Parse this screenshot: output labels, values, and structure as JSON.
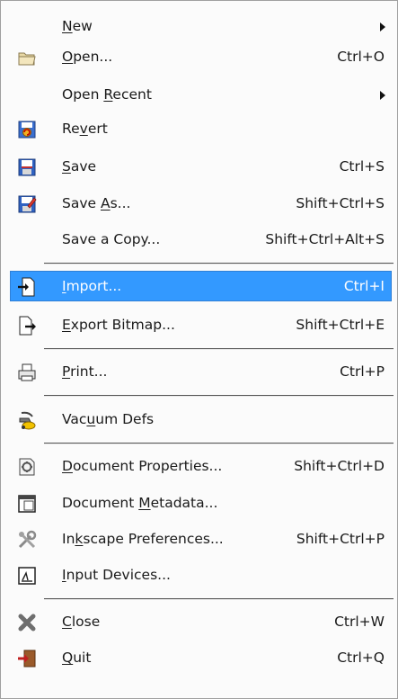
{
  "menu": {
    "items": [
      {
        "pre": "",
        "u": "N",
        "post": "ew",
        "accel": "",
        "submenu": true,
        "icon": ""
      },
      {
        "pre": "",
        "u": "O",
        "post": "pen...",
        "accel": "Ctrl+O",
        "icon": "folder-open-icon"
      },
      {
        "pre": "Open ",
        "u": "R",
        "post": "ecent",
        "accel": "",
        "submenu": true,
        "icon": ""
      },
      {
        "pre": "Re",
        "u": "v",
        "post": "ert",
        "accel": "",
        "icon": "revert-icon"
      },
      {
        "pre": "",
        "u": "S",
        "post": "ave",
        "accel": "Ctrl+S",
        "icon": "save-icon"
      },
      {
        "pre": "Save ",
        "u": "A",
        "post": "s...",
        "accel": "Shift+Ctrl+S",
        "icon": "save-as-icon"
      },
      {
        "pre": "Save a Copy...",
        "u": "",
        "post": "",
        "accel": "Shift+Ctrl+Alt+S",
        "icon": ""
      },
      {
        "pre": "",
        "u": "I",
        "post": "mport...",
        "accel": "Ctrl+I",
        "icon": "import-icon",
        "highlighted": true
      },
      {
        "pre": "",
        "u": "E",
        "post": "xport Bitmap...",
        "accel": "Shift+Ctrl+E",
        "icon": "export-icon"
      },
      {
        "pre": "",
        "u": "P",
        "post": "rint...",
        "accel": "Ctrl+P",
        "icon": "printer-icon"
      },
      {
        "pre": "Vac",
        "u": "u",
        "post": "um Defs",
        "accel": "",
        "icon": "vacuum-icon"
      },
      {
        "pre": "",
        "u": "D",
        "post": "ocument Properties...",
        "accel": "Shift+Ctrl+D",
        "icon": "document-properties-icon"
      },
      {
        "pre": "Document ",
        "u": "M",
        "post": "etadata...",
        "accel": "",
        "icon": "document-metadata-icon"
      },
      {
        "pre": "In",
        "u": "k",
        "post": "scape Preferences...",
        "accel": "Shift+Ctrl+P",
        "icon": "preferences-icon"
      },
      {
        "pre": "",
        "u": "I",
        "post": "nput Devices...",
        "accel": "",
        "icon": "input-devices-icon"
      },
      {
        "pre": "",
        "u": "C",
        "post": "lose",
        "accel": "Ctrl+W",
        "icon": "close-icon"
      },
      {
        "pre": "",
        "u": "Q",
        "post": "uit",
        "accel": "Ctrl+Q",
        "icon": "quit-icon"
      }
    ]
  }
}
